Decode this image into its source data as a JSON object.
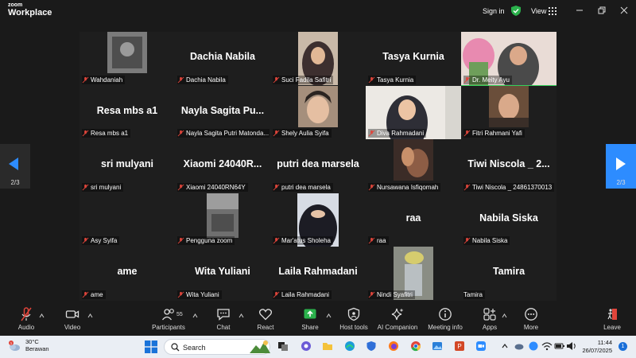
{
  "window": {
    "logo_top": "zoom",
    "logo_bottom": "Workplace",
    "signin": "Sign in",
    "view": "View"
  },
  "participants": [
    {
      "name": "Wahdaniah",
      "big": ""
    },
    {
      "name": "Dachia Nabila",
      "big": "Dachia Nabila"
    },
    {
      "name": "Suci Fadila Safitri",
      "big": ""
    },
    {
      "name": "Tasya Kurnia",
      "big": "Tasya Kurnia"
    },
    {
      "name": "Dr. Meity Ayu",
      "big": ""
    },
    {
      "name": "Resa mbs a1",
      "big": "Resa mbs a1"
    },
    {
      "name": "Nayla Sagita Putri Matonda...",
      "big": "Nayla Sagita Pu..."
    },
    {
      "name": "Shely Aulia Syifa",
      "big": ""
    },
    {
      "name": "Diva Rahmadani",
      "big": ""
    },
    {
      "name": "Fitri Rahmani Yafi",
      "big": ""
    },
    {
      "name": "sri mulyani",
      "big": "sri mulyani"
    },
    {
      "name": "Xiaomi 24040RN64Y",
      "big": "Xiaomi  24040R..."
    },
    {
      "name": "putri dea marsela",
      "big": "putri dea marsela"
    },
    {
      "name": "Nursawana Isfiqomah",
      "big": ""
    },
    {
      "name": "Tiwi Niscola _ 24861370013",
      "big": "Tiwi Niscola _ 2..."
    },
    {
      "name": "Asy Syifa",
      "big": ""
    },
    {
      "name": "Pengguna zoom",
      "big": ""
    },
    {
      "name": "Mar'atus Sholeha",
      "big": ""
    },
    {
      "name": "raa",
      "big": "raa"
    },
    {
      "name": "Nabila Siska",
      "big": "Nabila Siska"
    },
    {
      "name": "ame",
      "big": "ame"
    },
    {
      "name": "Wita Yuliani",
      "big": "Wita Yuliani"
    },
    {
      "name": "Laila Rahmadani",
      "big": "Laila Rahmadani"
    },
    {
      "name": "Nindi Syafitri",
      "big": ""
    },
    {
      "name": "Tamira",
      "big": "Tamira"
    }
  ],
  "pager": {
    "left": "2/3",
    "right": "2/3"
  },
  "toolbar": {
    "audio": "Audio",
    "video": "Video",
    "participants": "Participants",
    "participants_count": "55",
    "chat": "Chat",
    "react": "React",
    "share": "Share",
    "host_tools": "Host tools",
    "ai_companion": "AI Companion",
    "meeting_info": "Meeting info",
    "apps": "Apps",
    "more": "More",
    "leave": "Leave"
  },
  "taskbar": {
    "temp": "30°C",
    "weather": "Berawan",
    "weather_badge": "1",
    "search": "Search",
    "time": "11:44",
    "date": "26/07/2025",
    "notifications": "1"
  },
  "colors": {
    "active_speaker": "#35d05b",
    "accent": "#2d8cff",
    "mute": "#e0453b"
  }
}
